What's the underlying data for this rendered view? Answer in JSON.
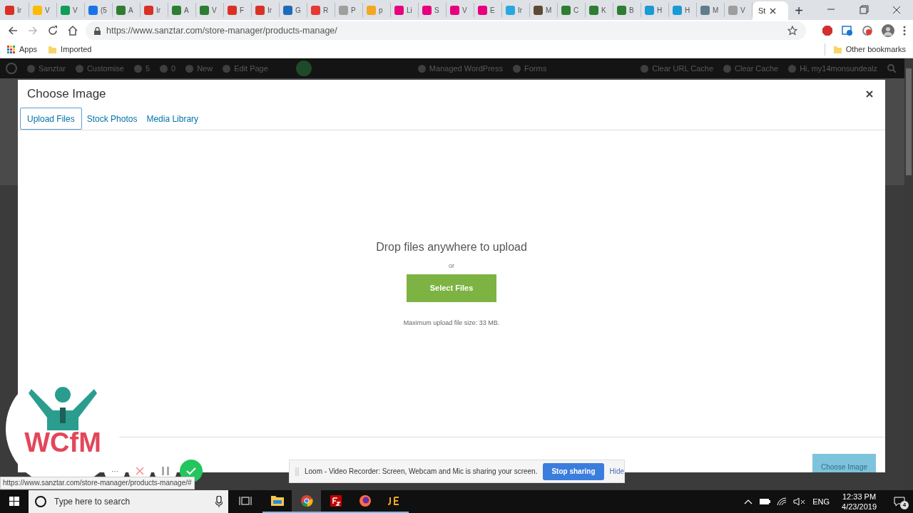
{
  "browser": {
    "tabs": [
      {
        "label": "Ir",
        "color": "#d93025",
        "selected": false
      },
      {
        "label": "V",
        "color": "#fbbc04",
        "selected": false
      },
      {
        "label": "V",
        "color": "#0f9d58",
        "selected": false
      },
      {
        "label": "(5",
        "color": "#1a73e8",
        "selected": false
      },
      {
        "label": "A",
        "color": "#2e7d32",
        "selected": false
      },
      {
        "label": "Ir",
        "color": "#d93025",
        "selected": false
      },
      {
        "label": "A",
        "color": "#2e7d32",
        "selected": false
      },
      {
        "label": "V",
        "color": "#2e7d32",
        "selected": false
      },
      {
        "label": "F",
        "color": "#d93025",
        "selected": false
      },
      {
        "label": "Ir",
        "color": "#d93025",
        "selected": false
      },
      {
        "label": "G",
        "color": "#1e6bb8",
        "selected": false
      },
      {
        "label": "R",
        "color": "#e53935",
        "selected": false
      },
      {
        "label": "P",
        "color": "#9e9e9e",
        "selected": false
      },
      {
        "label": "p",
        "color": "#f5a623",
        "selected": false
      },
      {
        "label": "Li",
        "color": "#e6007e",
        "selected": false
      },
      {
        "label": "S",
        "color": "#e6007e",
        "selected": false
      },
      {
        "label": "V",
        "color": "#e6007e",
        "selected": false
      },
      {
        "label": "E",
        "color": "#e6007e",
        "selected": false
      },
      {
        "label": "Ir",
        "color": "#29a8e0",
        "selected": false
      },
      {
        "label": "M",
        "color": "#5d4a36",
        "selected": false
      },
      {
        "label": "C",
        "color": "#2e7d32",
        "selected": false
      },
      {
        "label": "K",
        "color": "#2e7d32",
        "selected": false
      },
      {
        "label": "B",
        "color": "#2e7d32",
        "selected": false
      },
      {
        "label": "H",
        "color": "#1b9ad6",
        "selected": false
      },
      {
        "label": "H",
        "color": "#1b9ad6",
        "selected": false
      },
      {
        "label": "M",
        "color": "#607d8b",
        "selected": false
      },
      {
        "label": "V",
        "color": "#9e9e9e",
        "selected": false
      },
      {
        "label": "St",
        "selected": true
      }
    ],
    "new_tab": "+",
    "url": "https://www.sanztar.com/store-manager/products-manage/",
    "bookmarks": [
      {
        "label": "Apps",
        "kind": "apps"
      },
      {
        "label": "Imported",
        "kind": "folder"
      }
    ],
    "other_bookmarks": "Other bookmarks"
  },
  "admin_bar": {
    "items": [
      "Sanztar",
      "Customise",
      "5",
      "0",
      "New",
      "Edit Page"
    ],
    "right_items": [
      "Managed WordPress",
      "Forms"
    ],
    "end_items": [
      "Clear URL Cache",
      "Clear Cache",
      "Hi, my14monsundealz"
    ]
  },
  "modal": {
    "title": "Choose Image",
    "tabs": [
      {
        "label": "Upload Files",
        "selected": true
      },
      {
        "label": "Stock Photos",
        "selected": false
      },
      {
        "label": "Media Library",
        "selected": false
      }
    ],
    "drop_text": "Drop files anywhere to upload",
    "or": "or",
    "select_button": "Select Files",
    "max_size": "Maximum upload file size: 33 MB.",
    "choose_button": {
      "label": "Choose Image",
      "disabled": true
    }
  },
  "logo": {
    "text": "WCfM"
  },
  "recorder": {
    "more": "···"
  },
  "loom_bar": {
    "message": "Loom - Video Recorder: Screen, Webcam and Mic is sharing your screen.",
    "stop": "Stop sharing",
    "hide": "Hide"
  },
  "status_url": "https://www.sanztar.com/store-manager/products-manage/#",
  "taskbar": {
    "search_placeholder": "Type here to search",
    "apps": [
      {
        "kind": "explorer",
        "selected": false
      },
      {
        "kind": "chrome",
        "selected": true
      },
      {
        "kind": "filezilla",
        "selected": false
      },
      {
        "kind": "firefox",
        "selected": false
      },
      {
        "kind": "je",
        "selected": false
      }
    ],
    "language": "ENG",
    "time": "12:33 PM",
    "date": "4/23/2019",
    "notifications": "4"
  }
}
